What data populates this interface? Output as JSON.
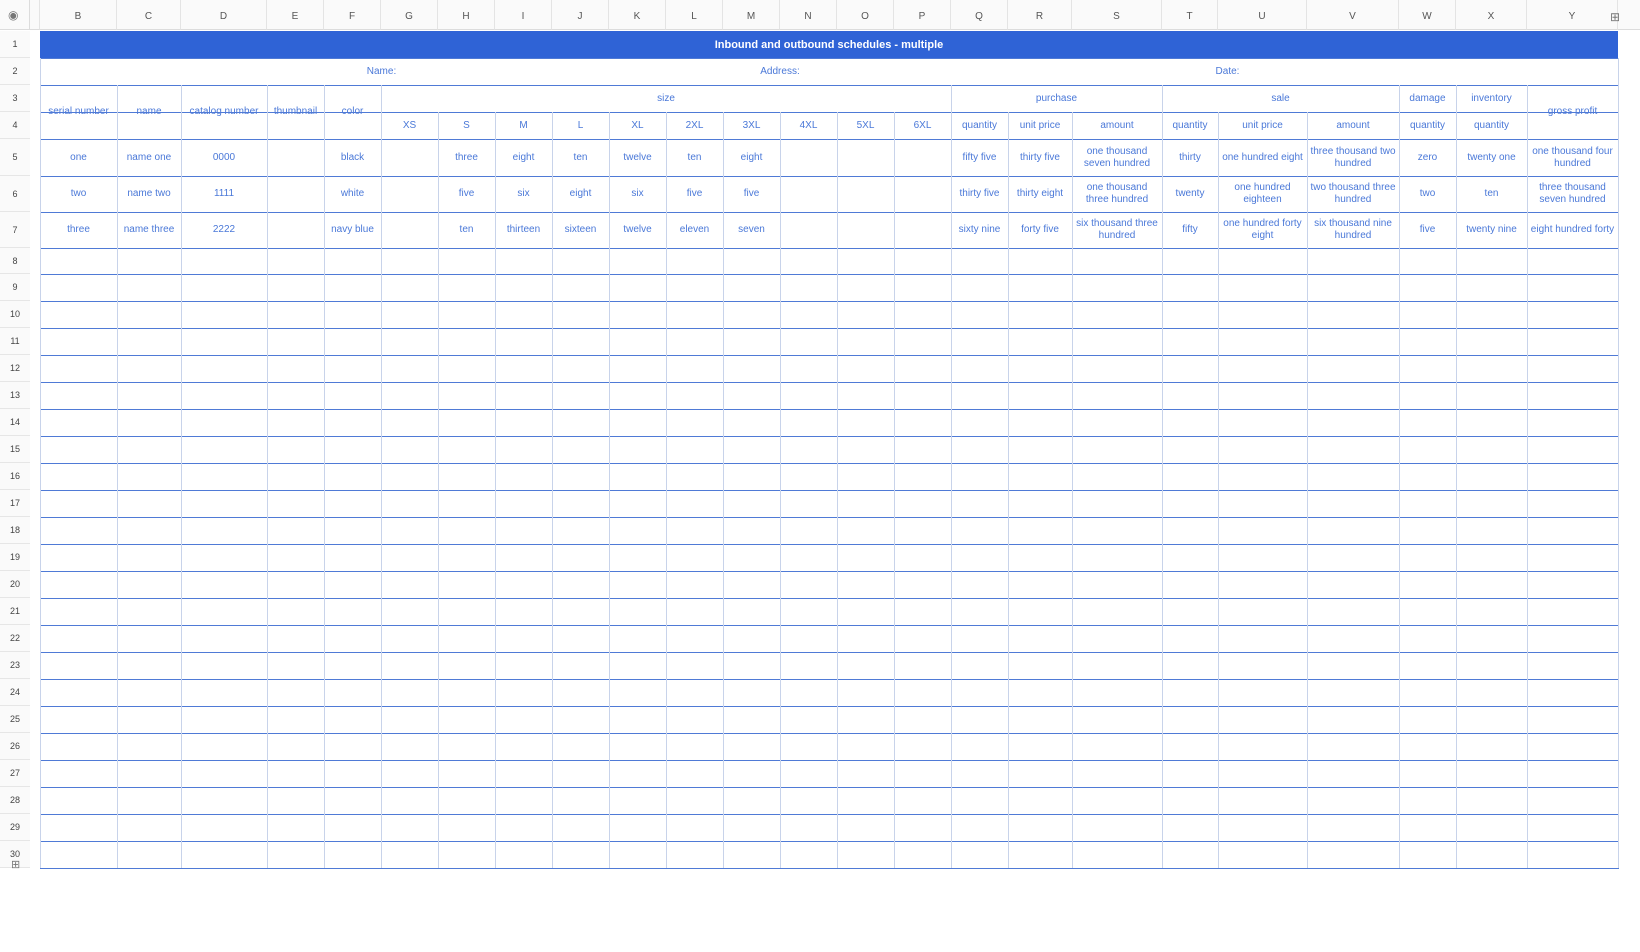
{
  "columns": [
    "B",
    "C",
    "D",
    "E",
    "F",
    "G",
    "H",
    "I",
    "J",
    "K",
    "L",
    "M",
    "N",
    "O",
    "P",
    "Q",
    "R",
    "S",
    "T",
    "U",
    "V",
    "W",
    "X",
    "Y"
  ],
  "row_numbers": [
    "1",
    "2",
    "3",
    "4",
    "5",
    "6",
    "7",
    "8",
    "9",
    "10",
    "11",
    "12",
    "13",
    "14",
    "15",
    "16",
    "17",
    "18",
    "19",
    "20",
    "21",
    "22",
    "23",
    "24",
    "25",
    "26",
    "27",
    "28",
    "29",
    "30"
  ],
  "title": "Inbound and outbound schedules - multiple",
  "info": {
    "name": "Name:",
    "address": "Address:",
    "date": "Date:"
  },
  "headers": {
    "serial_number": "serial number",
    "name": "name",
    "catalog_number": "catalog number",
    "thumbnail": "thumbnail",
    "color": "color",
    "size": "size",
    "sizes": [
      "XS",
      "S",
      "M",
      "L",
      "XL",
      "2XL",
      "3XL",
      "4XL",
      "5XL",
      "6XL"
    ],
    "purchase": "purchase",
    "purchase_sub": [
      "quantity",
      "unit price",
      "amount"
    ],
    "sale": "sale",
    "sale_sub": [
      "quantity",
      "unit price",
      "amount"
    ],
    "damage": "damage",
    "damage_sub": "quantity",
    "inventory": "inventory",
    "inventory_sub": "quantity",
    "gross_profit": "gross profit"
  },
  "rows": [
    [
      "one",
      "name one",
      "0000",
      "",
      "black",
      "",
      "three",
      "eight",
      "ten",
      "twelve",
      "ten",
      "eight",
      "",
      "",
      "",
      "fifty five",
      "thirty five",
      "one thousand seven hundred",
      "thirty",
      "one hundred eight",
      "three thousand two hundred",
      "zero",
      "twenty one",
      "one thousand four hundred"
    ],
    [
      "two",
      "name two",
      "1111",
      "",
      "white",
      "",
      "five",
      "six",
      "eight",
      "six",
      "five",
      "five",
      "",
      "",
      "",
      "thirty five",
      "thirty eight",
      "one thousand three hundred",
      "twenty",
      "one hundred eighteen",
      "two thousand three hundred",
      "two",
      "ten",
      "three thousand seven hundred"
    ],
    [
      "three",
      "name three",
      "2222",
      "",
      "navy blue",
      "",
      "ten",
      "thirteen",
      "sixteen",
      "twelve",
      "eleven",
      "seven",
      "",
      "",
      "",
      "sixty nine",
      "forty five",
      "six thousand three hundred",
      "fifty",
      "one hundred forty eight",
      "six thousand nine hundred",
      "five",
      "twenty nine",
      "eight hundred forty"
    ]
  ],
  "colors": {
    "accent": "#2f63d6",
    "text": "#4a78d8"
  }
}
